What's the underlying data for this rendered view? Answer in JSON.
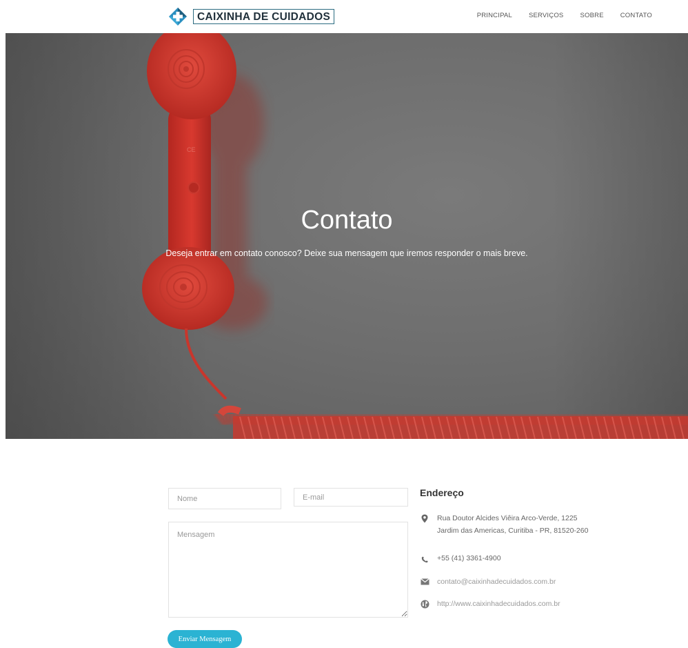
{
  "brand": {
    "name": "CAIXINHA DE CUIDADOS",
    "logo_icon": "diamond-cross-logo",
    "colors": {
      "logo_blue": "#2a8fc0",
      "logo_dark": "#1f4f6a",
      "accent": "#2bb3d3"
    }
  },
  "nav": {
    "items": [
      "PRINCIPAL",
      "SERVIÇOS",
      "SOBRE",
      "CONTATO"
    ]
  },
  "hero": {
    "title": "Contato",
    "subtitle": "Deseja entrar em contato conosco? Deixe sua mensagem que iremos responder o mais breve.",
    "image": "red-telephone-handset"
  },
  "form": {
    "name_placeholder": "Nome",
    "email_placeholder": "E-mail",
    "message_placeholder": "Mensagem",
    "submit_label": "Enviar Mensagem"
  },
  "address": {
    "title": "Endereço",
    "street": "Rua Doutor Alcides Viêira Arco-Verde, 1225",
    "city": "Jardim das Americas, Curitiba - PR, 81520-260",
    "phone": "+55 (41) 3361-4900",
    "email": "contato@caixinhadecuidados.com.br",
    "website": "http://www.caixinhadecuidados.com.br",
    "icons": [
      "map-pin-icon",
      "phone-icon",
      "envelope-icon",
      "globe-icon"
    ]
  }
}
